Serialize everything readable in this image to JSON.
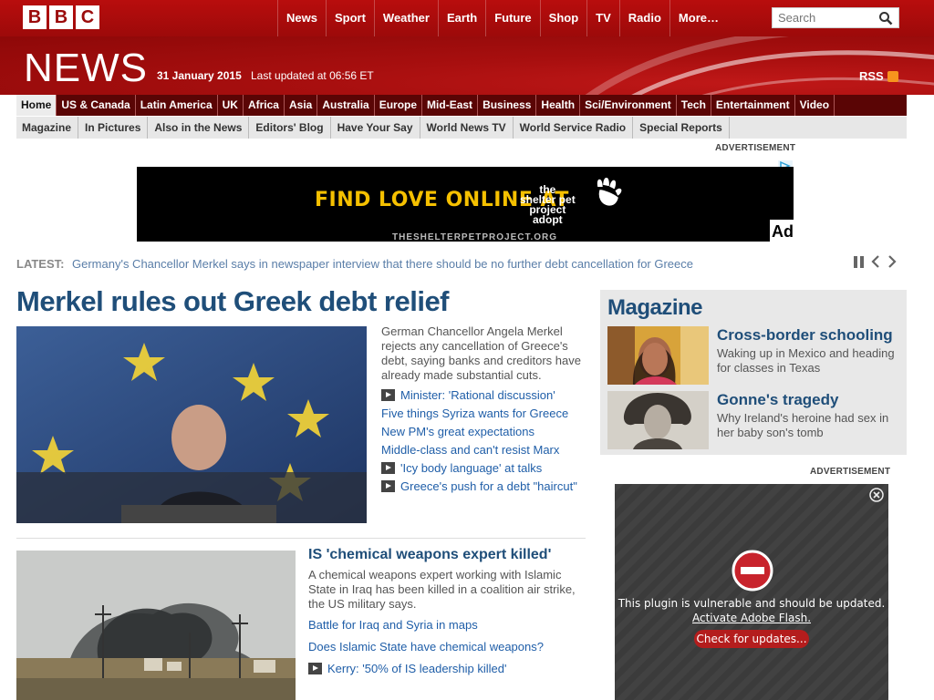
{
  "brand": {
    "letters": [
      "B",
      "B",
      "C"
    ],
    "news": "NEWS"
  },
  "topnav": [
    "News",
    "Sport",
    "Weather",
    "Earth",
    "Future",
    "Shop",
    "TV",
    "Radio",
    "More…"
  ],
  "search": {
    "placeholder": "Search"
  },
  "masthead": {
    "date": "31 January 2015",
    "updated": "Last updated at 06:56 ET",
    "rss": "RSS"
  },
  "sections": [
    "Home",
    "US & Canada",
    "Latin America",
    "UK",
    "Africa",
    "Asia",
    "Australia",
    "Europe",
    "Mid-East",
    "Business",
    "Health",
    "Sci/Environment",
    "Tech",
    "Entertainment",
    "Video"
  ],
  "subsections": [
    "Magazine",
    "In Pictures",
    "Also in the News",
    "Editors' Blog",
    "Have Your Say",
    "World News TV",
    "World Service Radio",
    "Special Reports"
  ],
  "ad_label": "ADVERTISEMENT",
  "banner": {
    "tagline": "FIND LOVE ONLINE AT",
    "brand_lines": [
      "the",
      "shelter pet",
      "project",
      "adopt"
    ],
    "url": "THESHELTERPETPROJECT.ORG",
    "corner": "Ad"
  },
  "latest": {
    "label": "LATEST:",
    "text": "Germany's Chancellor Merkel says in newspaper interview that there should be no further debt cancellation for Greece"
  },
  "main_story": {
    "headline": "Merkel rules out Greek debt relief",
    "summary": "German Chancellor Angela Merkel rejects any cancellation of Greece's debt, saying banks and creditors have already made substantial cuts.",
    "links": [
      {
        "text": "Minister: 'Rational discussion'",
        "video": true
      },
      {
        "text": "Five things Syriza wants for Greece",
        "video": false
      },
      {
        "text": "New PM's great expectations",
        "video": false
      },
      {
        "text": "Middle-class and can't resist Marx",
        "video": false
      },
      {
        "text": "'Icy body language' at talks",
        "video": true
      },
      {
        "text": "Greece's push for a debt \"haircut\"",
        "video": true
      }
    ]
  },
  "second_story": {
    "headline": "IS 'chemical weapons expert killed'",
    "summary": "A chemical weapons expert working with Islamic State in Iraq has been killed in a coalition air strike, the US military says.",
    "links": [
      {
        "text": "Battle for Iraq and Syria in maps",
        "video": false
      },
      {
        "text": "Does Islamic State have chemical weapons?",
        "video": false
      },
      {
        "text": "Kerry: '50% of IS leadership killed'",
        "video": true
      }
    ]
  },
  "magazine": {
    "title": "Magazine",
    "items": [
      {
        "title": "Cross-border schooling",
        "desc": "Waking up in Mexico and heading for classes in Texas"
      },
      {
        "title": "Gonne's tragedy",
        "desc": "Why Ireland's heroine had sex in her baby son's tomb"
      }
    ]
  },
  "flash_ad": {
    "message": "This plugin is vulnerable and should be updated.",
    "link": "Activate Adobe Flash.",
    "button": "Check for updates..."
  },
  "colors": {
    "bbc_red": "#b80d0d",
    "headline_blue": "#1f4e79",
    "link_blue": "#1f5ea8"
  }
}
